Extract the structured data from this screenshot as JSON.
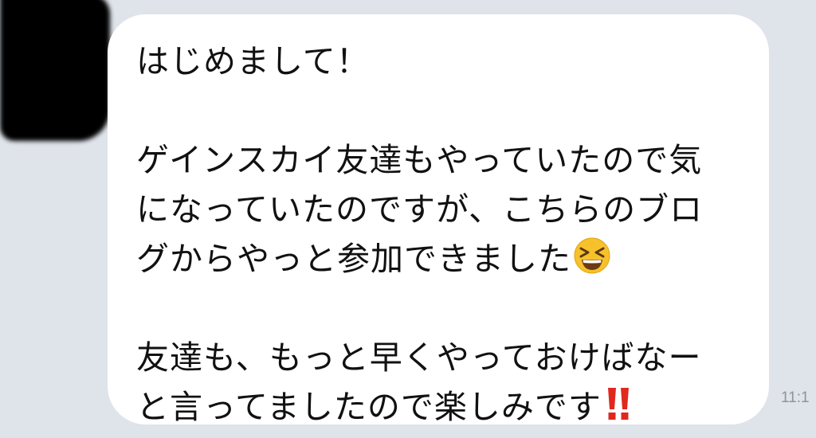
{
  "message": {
    "lines": [
      "はじめまして！",
      "",
      "ゲインスカイ友達もやっていたので気",
      "になっていたのですが、こちらのブロ",
      "グからやっと参加できました",
      "",
      "友達も、もっと早くやっておけばなー",
      "と言ってましたので楽しみです"
    ],
    "emoji_after_line_5": "grinning-squinting-face-icon",
    "emoji_after_line_8": "double-exclamation-icon"
  },
  "timestamp": "11:1",
  "colors": {
    "background": "#dfe3ea",
    "bubble": "#ffffff",
    "text": "#111111",
    "exclamation": "#e0281f",
    "emoji_face": "#f7c12c"
  }
}
